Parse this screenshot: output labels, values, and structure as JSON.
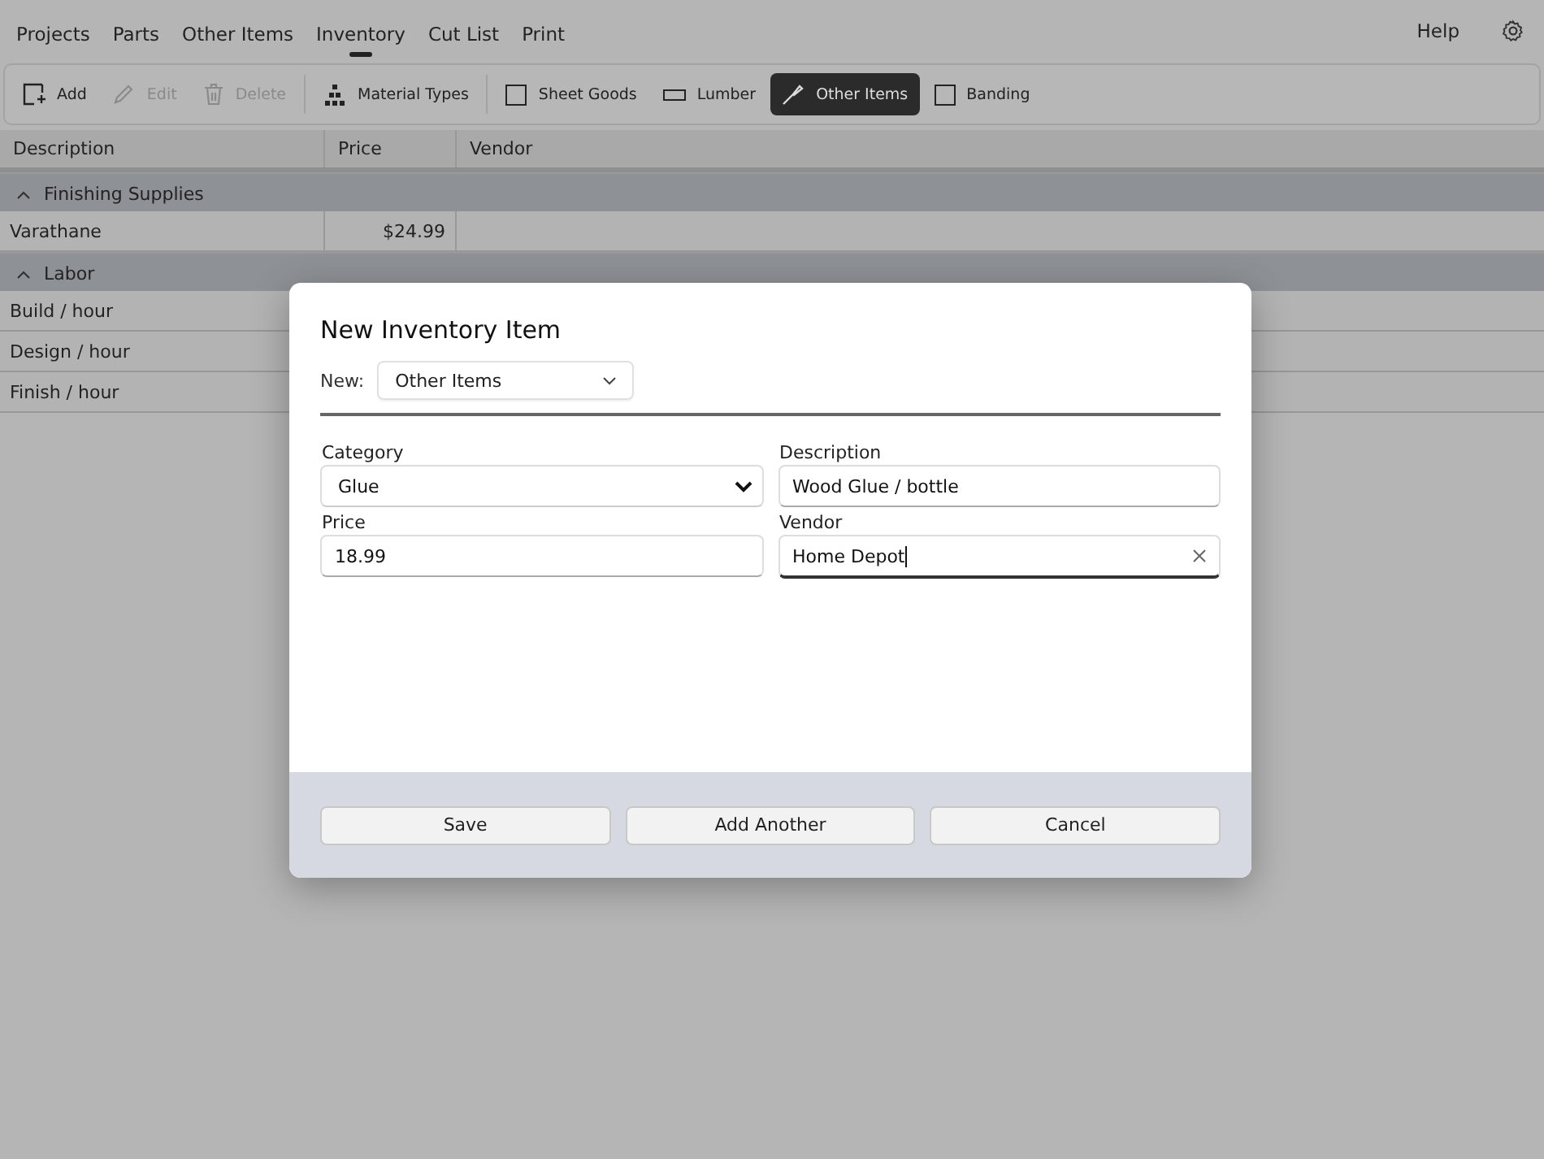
{
  "nav": {
    "tabs": [
      {
        "label": "Projects",
        "selected": false
      },
      {
        "label": "Parts",
        "selected": false
      },
      {
        "label": "Other Items",
        "selected": false
      },
      {
        "label": "Inventory",
        "selected": true
      },
      {
        "label": "Cut List",
        "selected": false
      },
      {
        "label": "Print",
        "selected": false
      }
    ],
    "help": "Help"
  },
  "toolbar": {
    "groups": [
      [
        {
          "label": "Add",
          "disabled": false,
          "selected": false
        },
        {
          "label": "Edit",
          "disabled": true,
          "selected": false
        },
        {
          "label": "Delete",
          "disabled": true,
          "selected": false
        }
      ],
      [
        {
          "label": "Material Types",
          "disabled": false,
          "selected": false
        }
      ],
      [
        {
          "label": "Sheet Goods",
          "disabled": false,
          "selected": false
        },
        {
          "label": "Lumber",
          "disabled": false,
          "selected": false
        },
        {
          "label": "Other Items",
          "disabled": false,
          "selected": true
        },
        {
          "label": "Banding",
          "disabled": false,
          "selected": false
        }
      ]
    ]
  },
  "table": {
    "columns": [
      "Description",
      "Price",
      "Vendor"
    ],
    "groups": [
      {
        "label": "Finishing Supplies",
        "expanded": true,
        "rows": [
          {
            "cells": [
              "Varathane",
              "$24.99"
            ]
          }
        ]
      },
      {
        "label": "Labor",
        "expanded": true,
        "rows": [
          {
            "cells": [
              "Build / hour"
            ]
          },
          {
            "cells": [
              "Design / hour"
            ]
          },
          {
            "cells": [
              "Finish / hour"
            ]
          }
        ]
      }
    ]
  },
  "dialog": {
    "title": "New Inventory Item",
    "new_label": "New:",
    "new_value": "Other Items",
    "fields": [
      {
        "kind": "select",
        "label": "Category",
        "value": "Glue",
        "focused": false
      },
      {
        "kind": "text",
        "label": "Description",
        "value": "Wood Glue / bottle",
        "focused": false
      },
      {
        "kind": "text",
        "label": "Price",
        "value": "18.99",
        "focused": false
      },
      {
        "kind": "clearable",
        "label": "Vendor",
        "value": "Home Depot",
        "focused": true
      }
    ],
    "buttons": [
      "Save",
      "Add Another",
      "Cancel"
    ]
  }
}
